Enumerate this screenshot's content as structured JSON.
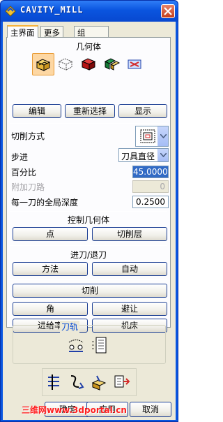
{
  "window": {
    "title": "CAVITY_MILL"
  },
  "tabs": [
    {
      "label": "主界面"
    },
    {
      "label": "更多"
    },
    {
      "label": "组"
    }
  ],
  "geometry": {
    "title": "几何体",
    "icons": [
      "geometry-body-icon",
      "part-geometry-icon",
      "blank-geometry-icon",
      "check-geometry-icon",
      "cut-area-icon"
    ],
    "edit_label": "编辑",
    "reselect_label": "重新选择",
    "display_label": "显示"
  },
  "cut": {
    "method_label": "切削方式",
    "method_icon": "follow-periphery-icon",
    "stepover_label": "步进",
    "stepover_value": "刀具直径",
    "percent_label": "百分比",
    "percent_value": "45.0000",
    "extra_passes_label": "附加刀路",
    "extra_passes_value": "0",
    "global_depth_label": "每一刀的全局深度",
    "global_depth_value": "0.2500"
  },
  "control_geometry": {
    "title": "控制几何体",
    "point_label": "点",
    "cut_levels_label": "切削层"
  },
  "engage": {
    "title": "进刀/退刀",
    "method_label": "方法",
    "auto_label": "自动"
  },
  "cutting": {
    "cut_label": "切削",
    "corner_label": "角",
    "avoidance_label": "避让",
    "feeds_label": "进给率",
    "machine_label": "机床"
  },
  "toolpath": {
    "title": "刀轨"
  },
  "bottom": {
    "ok_label": "确定",
    "apply_label": "应用",
    "cancel_label": "取消",
    "watermark": "三维网www.3dportal.cn"
  },
  "colors": {
    "titlebar": "#0a55df",
    "dialog_bg": "#ece9d8",
    "selection": "#316ac5",
    "group_title": "#0046d5",
    "watermark": "#ff2020"
  }
}
